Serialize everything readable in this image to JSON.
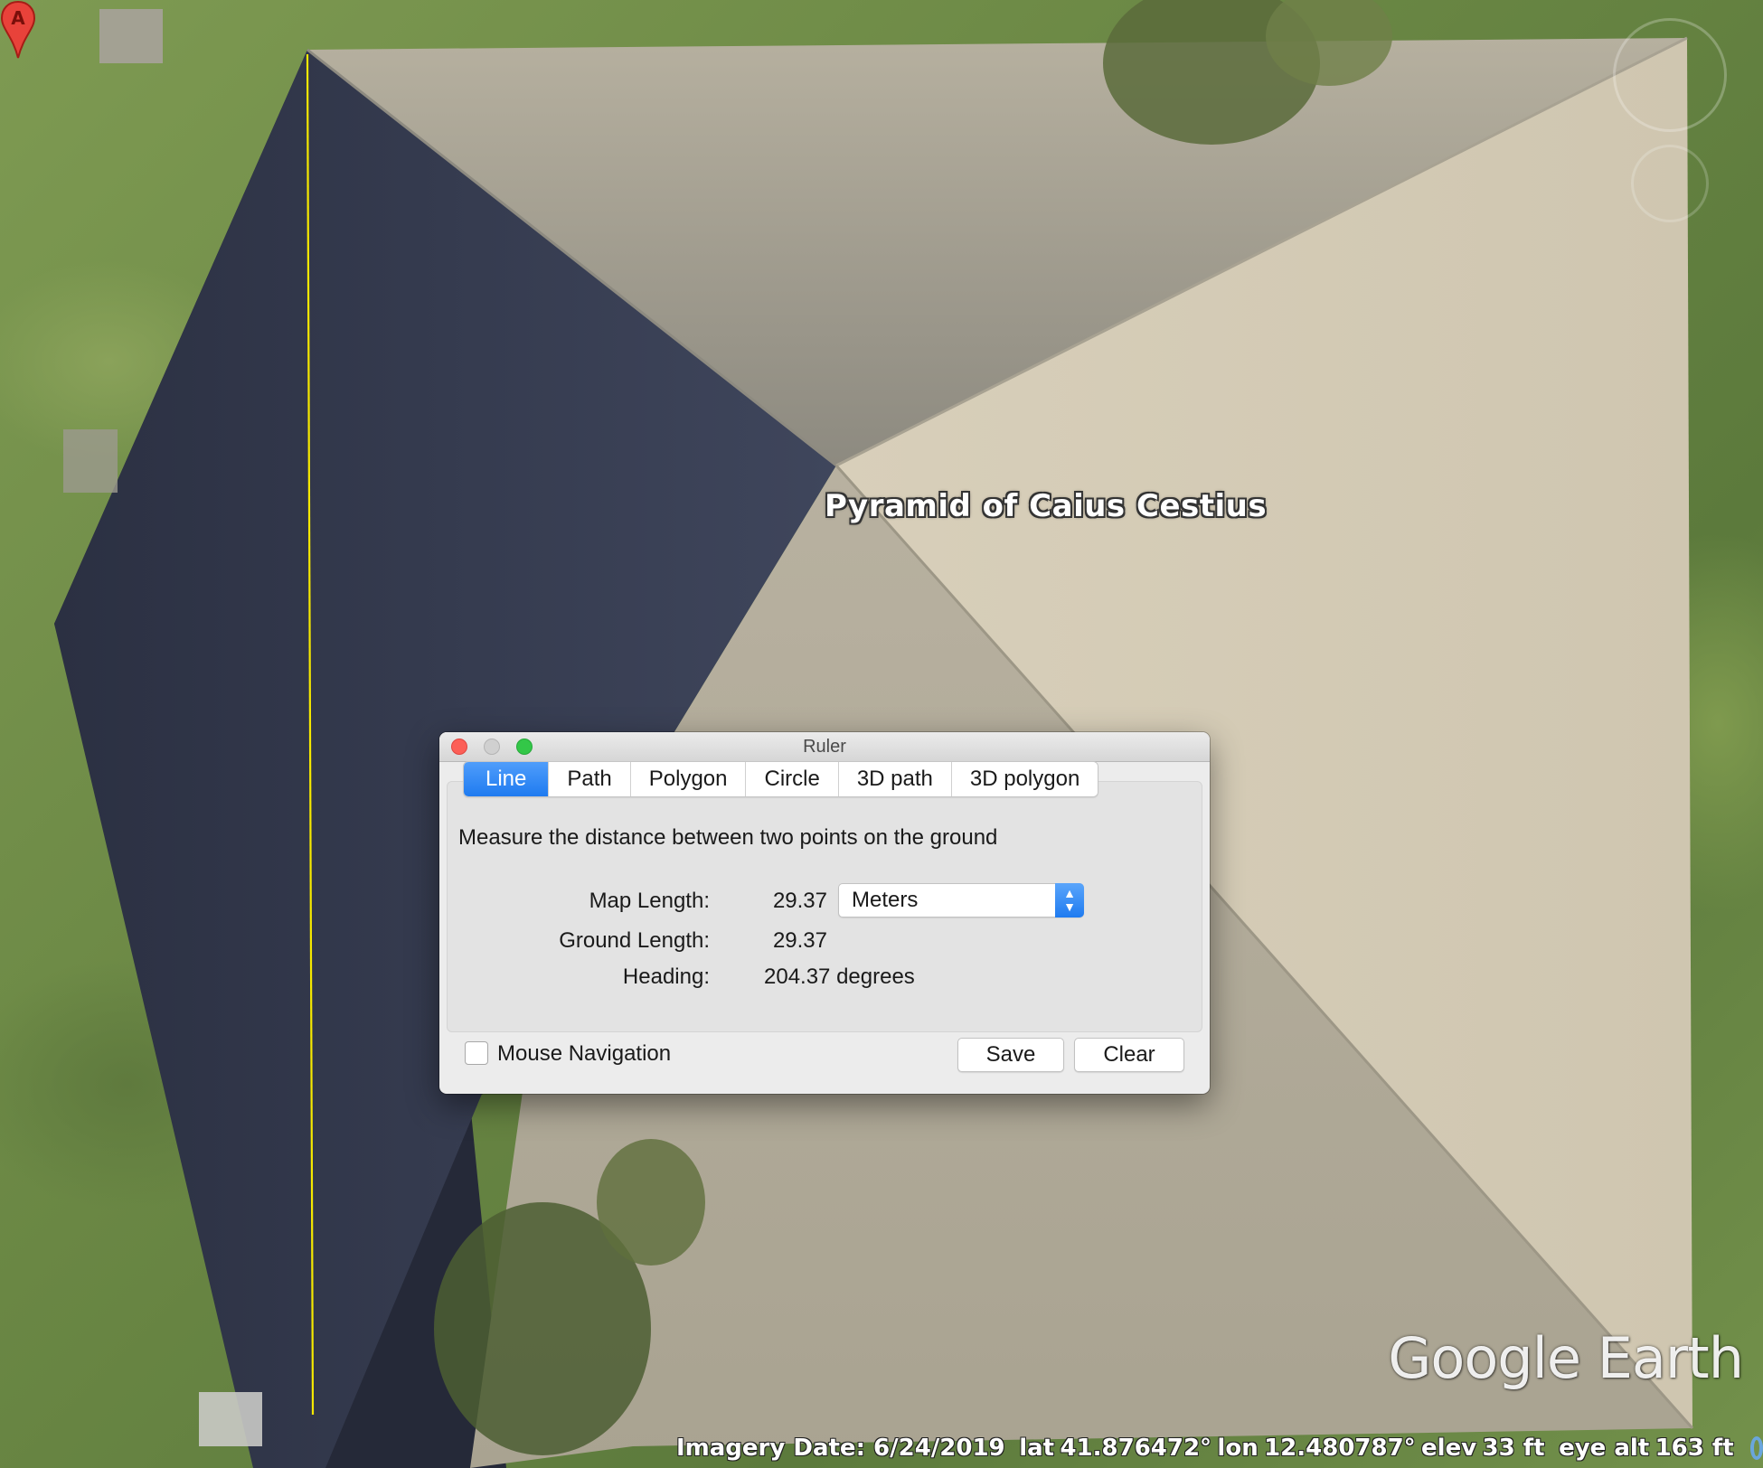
{
  "map": {
    "place_label": "Pyramid of Caius Cestius",
    "marker_letter": "A",
    "brand": "Google Earth",
    "measure_line_color": "#f5e800"
  },
  "status": {
    "imagery_date": "Imagery Date: 6/24/2019",
    "lat_label": "lat",
    "lat_value": "41.876472°",
    "lon_label": "lon",
    "lon_value": "12.480787°",
    "elev_label": "elev",
    "elev_value": "33 ft",
    "eye_alt_label": "eye alt",
    "eye_alt_value": "163 ft"
  },
  "ruler": {
    "title": "Ruler",
    "tabs": [
      "Line",
      "Path",
      "Polygon",
      "Circle",
      "3D path",
      "3D polygon"
    ],
    "active_tab": "Line",
    "description": "Measure the distance between two points on the ground",
    "map_length_label": "Map Length:",
    "map_length_value": "29.37",
    "unit": "Meters",
    "ground_length_label": "Ground Length:",
    "ground_length_value": "29.37",
    "heading_label": "Heading:",
    "heading_value": "204.37 degrees",
    "mouse_nav_label": "Mouse Navigation",
    "mouse_nav_checked": false,
    "save_label": "Save",
    "clear_label": "Clear"
  },
  "colors": {
    "accent": "#1f7bf0",
    "close": "#fc5f57",
    "zoom": "#33c748",
    "marker": "#e8423a"
  }
}
